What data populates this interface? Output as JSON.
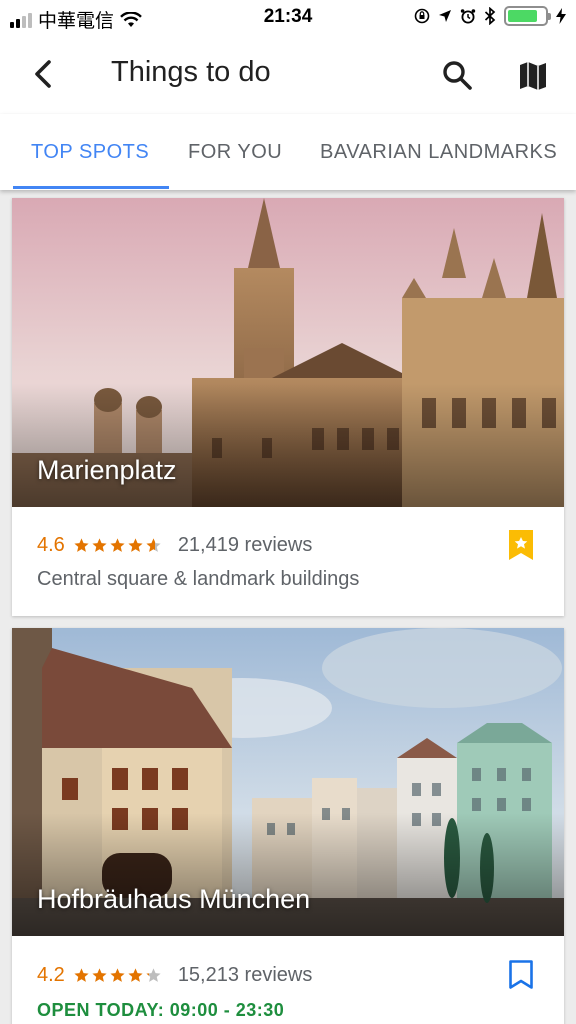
{
  "status_bar": {
    "carrier": "中華電信",
    "time": "21:34"
  },
  "header": {
    "title": "Things to do",
    "icons": [
      "back-arrow-icon",
      "search-icon",
      "map-icon"
    ]
  },
  "tabs": [
    {
      "label": "TOP SPOTS",
      "active": true
    },
    {
      "label": "FOR YOU",
      "active": false
    },
    {
      "label": "BAVARIAN LANDMARKS",
      "active": false
    }
  ],
  "places": [
    {
      "name": "Marienplatz",
      "rating": "4.6",
      "stars": 4.6,
      "reviews": "21,419 reviews",
      "description": "Central square & landmark buildings",
      "saved": true
    },
    {
      "name": "Hofbräuhaus München",
      "rating": "4.2",
      "stars": 4.2,
      "reviews": "15,213 reviews",
      "hours": "OPEN TODAY: 09:00 - 23:30",
      "saved": false
    }
  ],
  "colors": {
    "accent": "#4285f4",
    "rating": "#e37400",
    "bookmark_saved": "#fbbc04",
    "bookmark_unsaved": "#1a73e8",
    "open": "#1e8e3e"
  }
}
